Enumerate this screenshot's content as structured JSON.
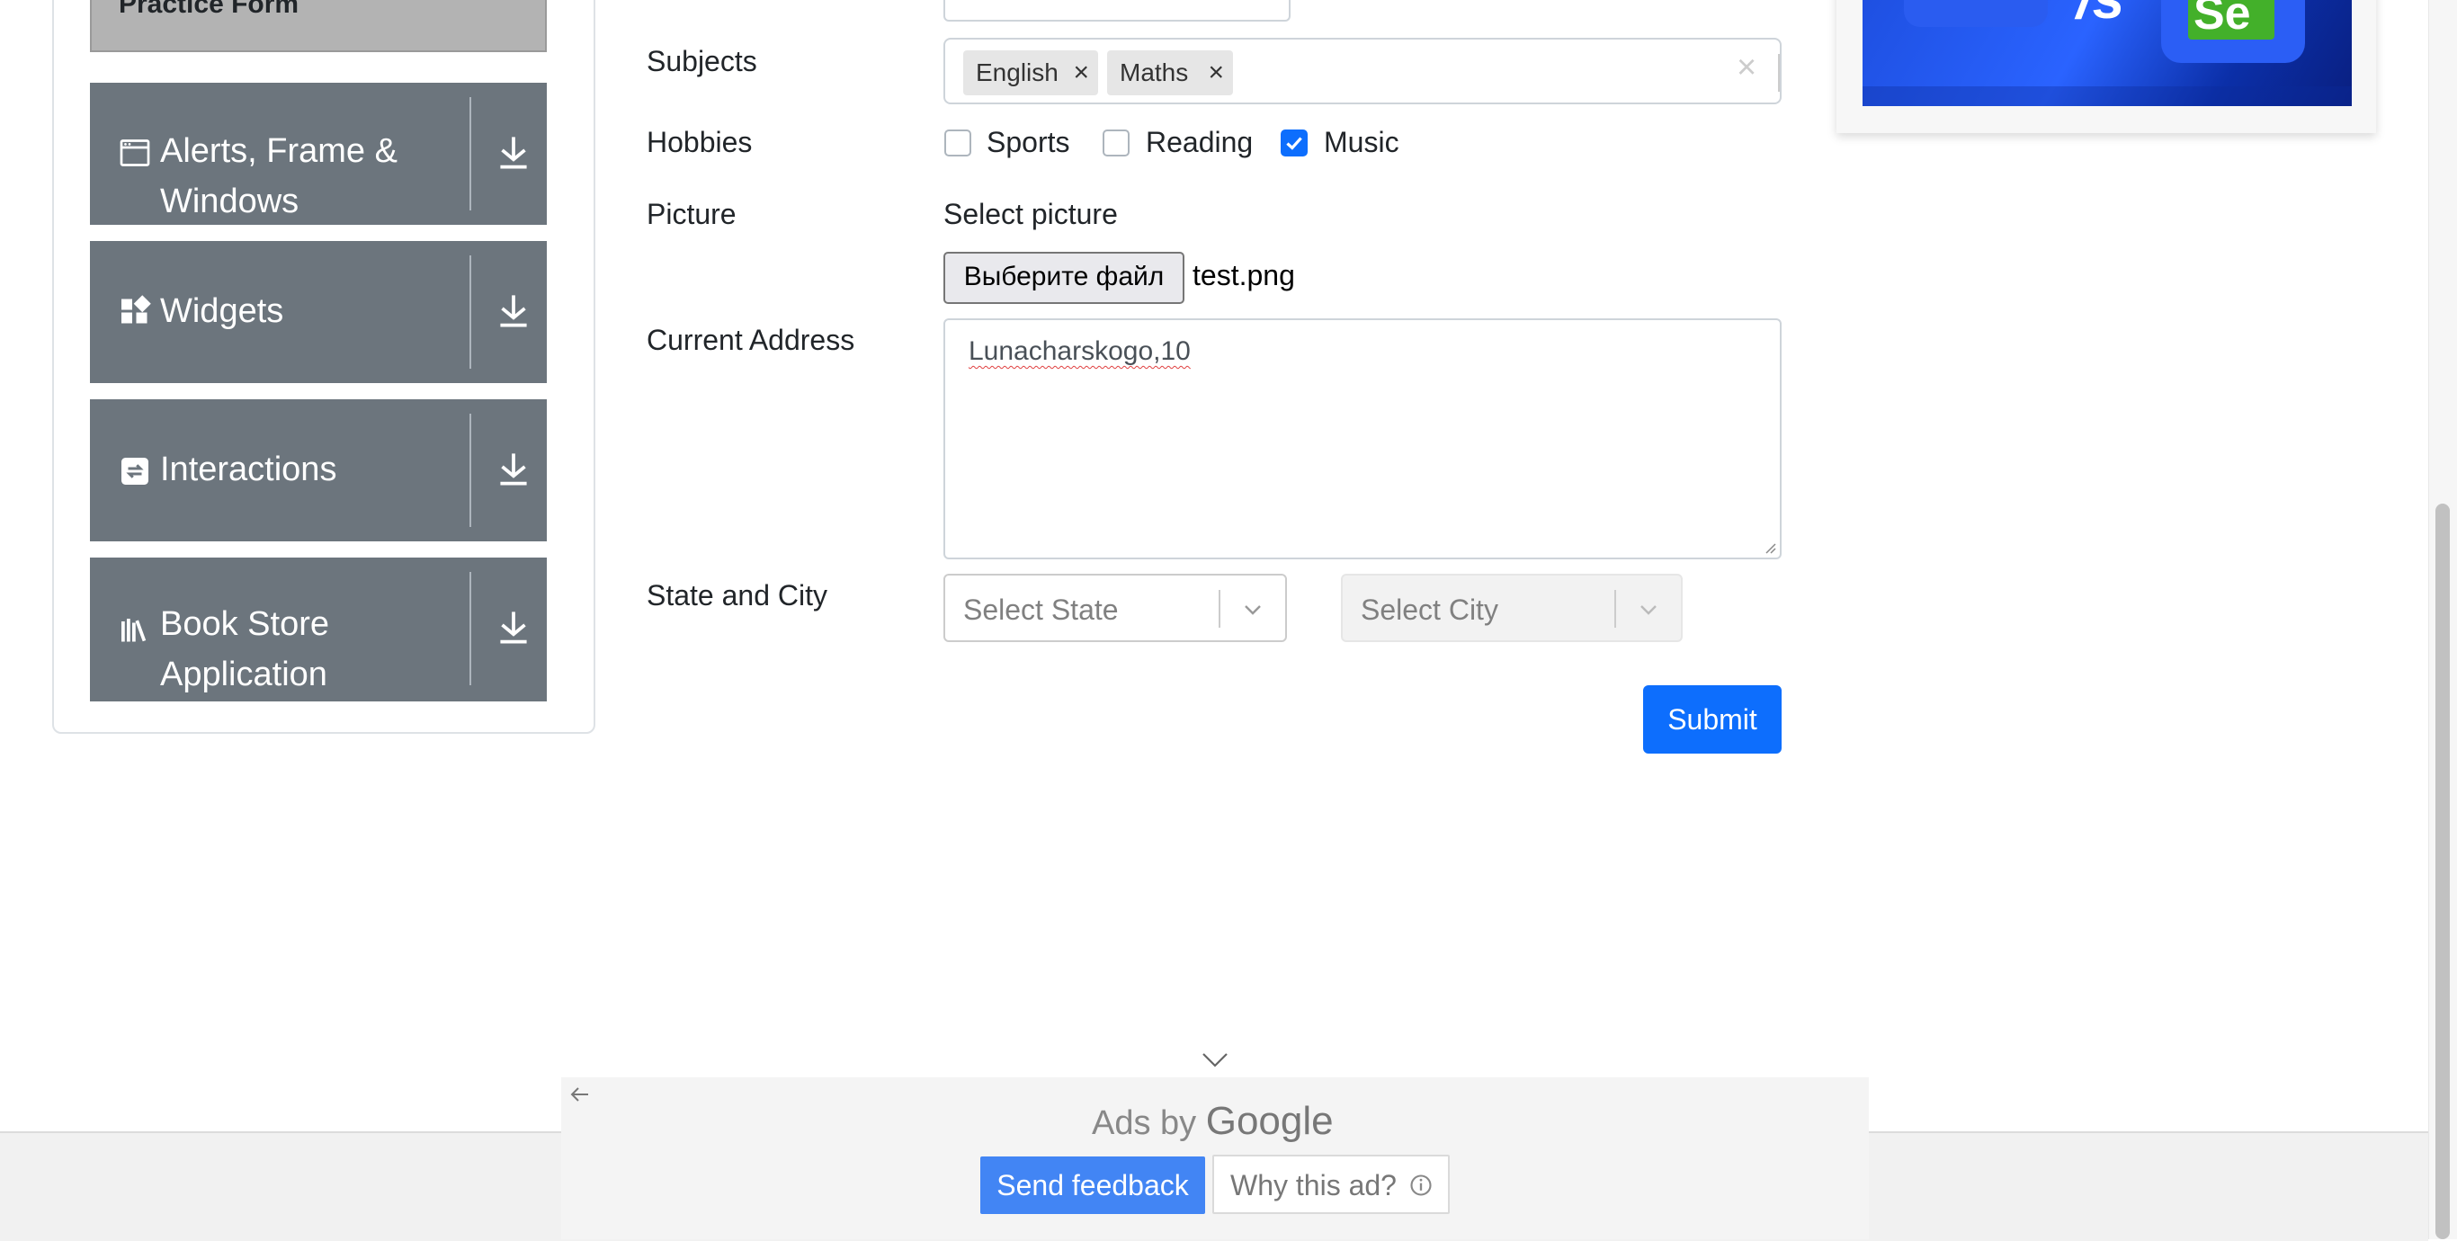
{
  "sidebar": {
    "practice_form_label": "Practice Form",
    "groups": [
      {
        "label": "Alerts, Frame & Windows",
        "icon": "browser-window-icon"
      },
      {
        "label": "Widgets",
        "icon": "widgets-icon"
      },
      {
        "label": "Interactions",
        "icon": "interactions-icon"
      },
      {
        "label": "Book Store Application",
        "icon": "books-icon"
      }
    ]
  },
  "form": {
    "subjects_label": "Subjects",
    "subjects": [
      "English",
      "Maths"
    ],
    "hobbies_label": "Hobbies",
    "hobbies": [
      {
        "label": "Sports",
        "checked": false
      },
      {
        "label": "Reading",
        "checked": false
      },
      {
        "label": "Music",
        "checked": true
      }
    ],
    "picture_label": "Picture",
    "select_picture_label": "Select picture",
    "file_button_label": "Выберите файл",
    "file_name": "test.png",
    "current_address_label": "Current Address",
    "current_address_value": "Lunacharskogo,10",
    "state_city_label": "State and City",
    "state_placeholder": "Select State",
    "city_placeholder": "Select City",
    "submit_label": "Submit",
    "remove_chip_glyph": "×",
    "clear_glyph": "×"
  },
  "bottom_ad": {
    "ads_by": "Ads by",
    "google": "Google",
    "send_feedback": "Send feedback",
    "why_this_ad": "Why this ad?"
  },
  "colors": {
    "sidebar_header": "#6c757d",
    "primary": "#0d6efd",
    "feedback_blue": "#4285f4"
  }
}
